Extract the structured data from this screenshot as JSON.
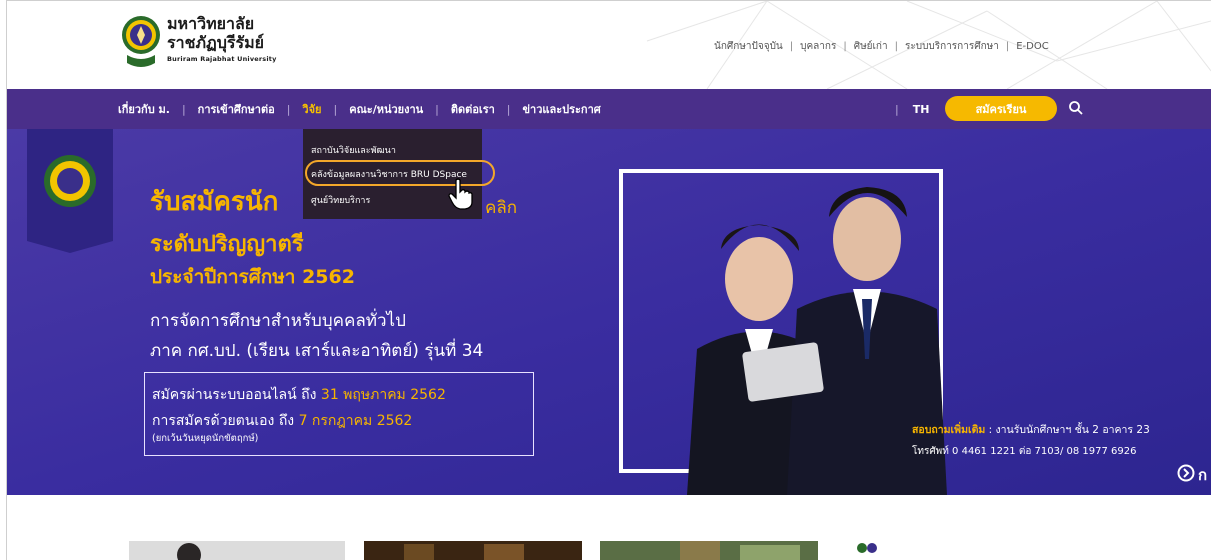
{
  "header": {
    "university_th_line1": "มหาวิทยาลัย",
    "university_th_line2": "ราชภัฏบุรีรัมย์",
    "university_en": "Buriram Rajabhat University",
    "toplinks": [
      "นักศึกษาปัจจุบัน",
      "บุคลากร",
      "ศิษย์เก่า",
      "ระบบบริการการศึกษา",
      "E-DOC"
    ]
  },
  "nav": {
    "items": [
      "เกี่ยวกับ ม.",
      "การเข้าศึกษาต่อ",
      "วิจัย",
      "คณะ/หน่วยงาน",
      "ติดต่อเรา",
      "ข่าวและประกาศ"
    ],
    "active_index": 2,
    "lang": "TH",
    "apply_label": "สมัครเรียน"
  },
  "dropdown": {
    "items": [
      "สถาบันวิจัยและพัฒนา",
      "คลังข้อมูลผลงานวิชาการ BRU DSpace",
      "ศูนย์วิทยบริการ"
    ],
    "highlighted_index": 1
  },
  "hero": {
    "title1": "รับสมัครนัก",
    "click_label": "คลิก",
    "title2": "ระดับปริญญาตรี",
    "title3": "ประจำปีการศึกษา 2562",
    "sub1": "การจัดการศึกษาสำหรับบุคคลทั่วไป",
    "sub2": "ภาค กศ.บป. (เรียน เสาร์และอาทิตย์) รุ่นที่ 34",
    "box_line1_prefix": "สมัครผ่านระบบออนไลน์ ถึง ",
    "box_line1_date": "31 พฤษภาคม 2562",
    "box_line2_prefix": "การสมัครด้วยตนเอง ถึง ",
    "box_line2_date": "7 กรกฎาคม 2562",
    "box_line3": "(ยกเว้นวันหยุดนักขัตฤกษ์)",
    "contact_label": "สอบถามเพิ่มเติม",
    "contact_text": " : งานรับนักศึกษาฯ ชั้น 2 อาคาร 23",
    "phone_text": "โทรศัพท์ 0 4461 1221 ต่อ 7103/ 08 1977 6926",
    "next_tail": "ก"
  },
  "colors": {
    "nav_bg": "#4a2f8a",
    "hero_bg": "#3b2aa0",
    "accent_yellow": "#f6b900",
    "dropdown_bg": "#2a1f2f",
    "highlight_ring": "#f3a72a"
  }
}
